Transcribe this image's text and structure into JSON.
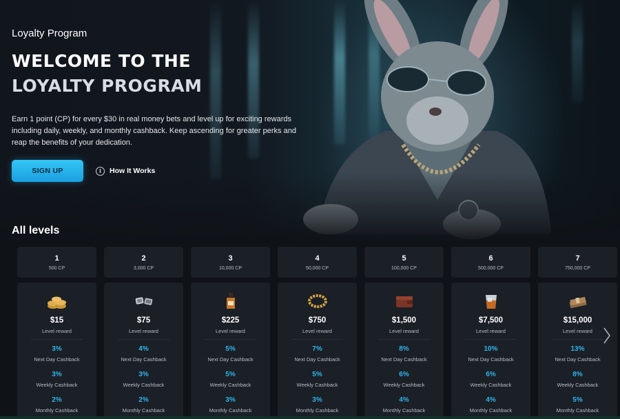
{
  "hero": {
    "eyebrow": "Loyalty Program",
    "title_line1": "WELCOME TO THE",
    "title_line2": "LOYALTY PROGRAM",
    "description": "Earn 1 point (CP) for every $30 in real money bets and level up for exciting rewards including daily, weekly, and monthly cashback. Keep ascending for greater perks and reap the benefits of your dedication.",
    "signup_label": "SIGN UP",
    "how_it_works_label": "How It Works",
    "info_icon": "info-circle-icon"
  },
  "levels_section": {
    "title": "All levels",
    "reward_label": "Level reward",
    "next_day_label": "Next Day Cashback",
    "weekly_label": "Weekly Cashback",
    "monthly_label": "Monthly Cashback",
    "next_icon": "chevron-right-icon",
    "levels": [
      {
        "level": "1",
        "cp": "500 CP",
        "reward": "$15",
        "icon": "coins-icon",
        "next_day": "3%",
        "weekly": "3%",
        "monthly": "2%"
      },
      {
        "level": "2",
        "cp": "3,000 CP",
        "reward": "$75",
        "icon": "cufflinks-icon",
        "next_day": "4%",
        "weekly": "3%",
        "monthly": "2%"
      },
      {
        "level": "3",
        "cp": "10,000 CP",
        "reward": "$225",
        "icon": "whiskey-bottle-icon",
        "next_day": "5%",
        "weekly": "5%",
        "monthly": "3%"
      },
      {
        "level": "4",
        "cp": "50,000 CP",
        "reward": "$750",
        "icon": "gold-chain-icon",
        "next_day": "7%",
        "weekly": "5%",
        "monthly": "3%"
      },
      {
        "level": "5",
        "cp": "100,000 CP",
        "reward": "$1,500",
        "icon": "wallet-icon",
        "next_day": "8%",
        "weekly": "6%",
        "monthly": "4%"
      },
      {
        "level": "6",
        "cp": "500,000 CP",
        "reward": "$7,500",
        "icon": "whiskey-glass-icon",
        "next_day": "10%",
        "weekly": "6%",
        "monthly": "4%"
      },
      {
        "level": "7",
        "cp": "750,000 CP",
        "reward": "$15,000",
        "icon": "cash-stack-icon",
        "next_day": "13%",
        "weekly": "8%",
        "monthly": "5%"
      }
    ]
  },
  "colors": {
    "accent": "#2eb6ee",
    "card_bg": "#1b1f26",
    "page_bg": "#0f1217"
  }
}
